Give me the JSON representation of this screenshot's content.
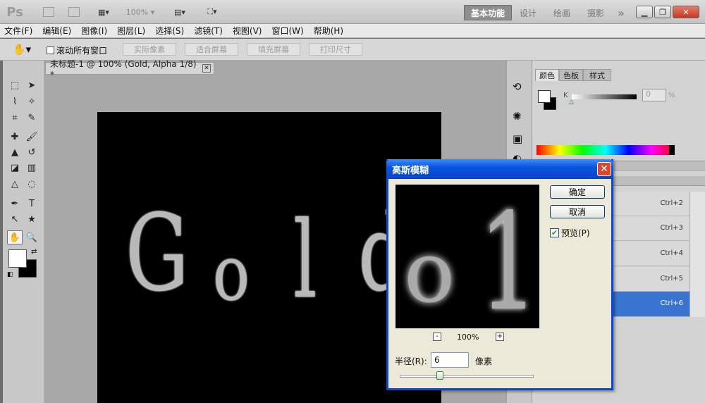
{
  "app": {
    "logo": "Ps"
  },
  "titlebar": {
    "zoom": "100%",
    "workspaces": [
      "基本功能",
      "设计",
      "绘画",
      "摄影"
    ],
    "more": "»"
  },
  "menu": [
    "文件(F)",
    "编辑(E)",
    "图像(I)",
    "图层(L)",
    "选择(S)",
    "滤镜(T)",
    "视图(V)",
    "窗口(W)",
    "帮助(H)"
  ],
  "options": {
    "scroll_all_label": "滚动所有窗口",
    "buttons": [
      "实际像素",
      "适合屏幕",
      "填充屏幕",
      "打印尺寸"
    ]
  },
  "document": {
    "tab_title": "未标题-1 @ 100% (Gold, Alpha 1/8) *",
    "canvas_text": [
      "G",
      "o",
      "l",
      "d"
    ]
  },
  "color_panel": {
    "tabs": [
      "颜色",
      "色板",
      "样式"
    ],
    "channel_label": "K",
    "value": "0",
    "unit": "%"
  },
  "shortcuts": [
    "Ctrl+2",
    "Ctrl+3",
    "Ctrl+4",
    "Ctrl+5",
    "Ctrl+6"
  ],
  "dialog": {
    "title": "高斯模糊",
    "ok": "确定",
    "cancel": "取消",
    "preview_label": "预览(P)",
    "preview_checked": true,
    "zoom_out": "-",
    "zoom_in": "+",
    "zoom_level": "100%",
    "radius_label": "半径(R):",
    "radius_value": "6",
    "radius_unit": "像素",
    "preview_text": [
      "o",
      "1"
    ]
  },
  "colors": {
    "accent": "#0a46d8",
    "selection": "#3874d0"
  }
}
